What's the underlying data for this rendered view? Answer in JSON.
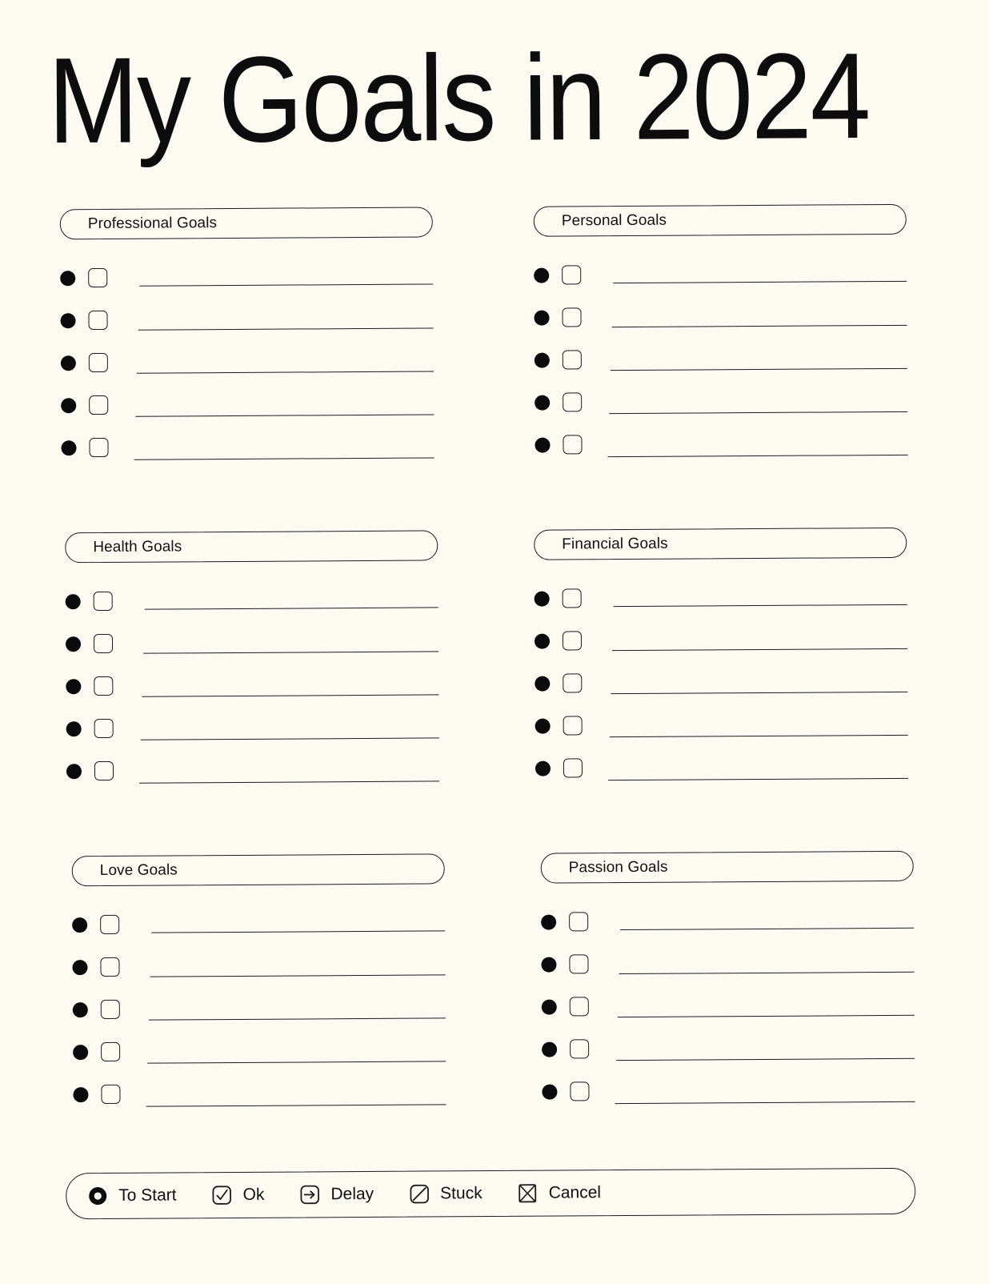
{
  "page": {
    "title": "My Goals in 2024",
    "background_color": "#fdfbf1",
    "ink_color": "#111111"
  },
  "sections": [
    {
      "id": "professional",
      "label": "Professional Goals",
      "column": "left",
      "row_count": 5,
      "rows": [
        "",
        "",
        "",
        "",
        ""
      ]
    },
    {
      "id": "personal",
      "label": "Personal Goals",
      "column": "right",
      "row_count": 5,
      "rows": [
        "",
        "",
        "",
        "",
        ""
      ]
    },
    {
      "id": "health",
      "label": "Health Goals",
      "column": "left",
      "row_count": 5,
      "rows": [
        "",
        "",
        "",
        "",
        ""
      ]
    },
    {
      "id": "financial",
      "label": "Financial Goals",
      "column": "right",
      "row_count": 5,
      "rows": [
        "",
        "",
        "",
        "",
        ""
      ]
    },
    {
      "id": "love",
      "label": "Love Goals",
      "column": "left",
      "row_count": 5,
      "rows": [
        "",
        "",
        "",
        "",
        ""
      ]
    },
    {
      "id": "passion",
      "label": "Passion Goals",
      "column": "right",
      "row_count": 5,
      "rows": [
        "",
        "",
        "",
        "",
        ""
      ]
    }
  ],
  "legend": {
    "items": [
      {
        "label": "To Start",
        "icon": "filled-ring-icon"
      },
      {
        "label": "Ok",
        "icon": "check-box-icon"
      },
      {
        "label": "Delay",
        "icon": "arrow-right-box-icon"
      },
      {
        "label": "Stuck",
        "icon": "slash-box-icon"
      },
      {
        "label": "Cancel",
        "icon": "x-box-icon"
      }
    ]
  }
}
